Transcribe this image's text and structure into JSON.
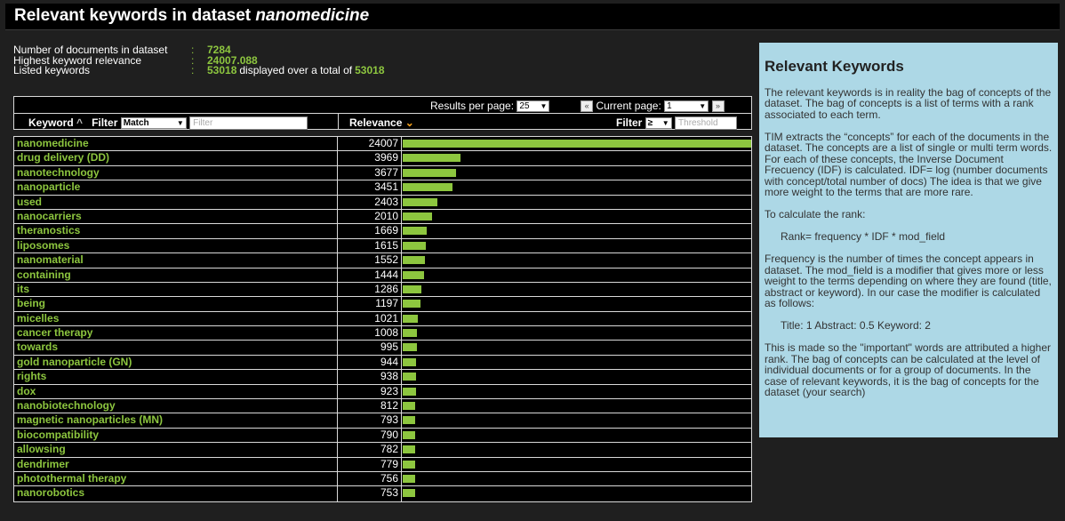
{
  "title": {
    "prefix": "Relevant keywords in dataset ",
    "dataset": "nanomedicine"
  },
  "stats": {
    "docs_label": "Number of documents in dataset",
    "docs_value": "7284",
    "highest_label": "Highest keyword relevance",
    "highest_value": "24007.088",
    "listed_label": "Listed keywords",
    "listed_value": "53018",
    "listed_middle": "displayed over a total of",
    "listed_total": "53018",
    "sep": ":"
  },
  "controls": {
    "results_per_page_label": "Results per page:",
    "results_per_page_value": "25",
    "prev_label": "«",
    "current_page_label": "Current page:",
    "current_page_value": "1",
    "next_label": "»",
    "keyword_header": "Keyword",
    "filter_label": "Filter",
    "filter_mode": "Match",
    "filter_placeholder": "Filter",
    "relevance_header": "Relevance",
    "threshold_filter_label": "Filter",
    "threshold_op": "≥",
    "threshold_placeholder": "Threshold",
    "sort_up_arrow": "^",
    "sort_down_arrow": "⌄",
    "select_arrow": "▼"
  },
  "keywords": [
    {
      "term": "nanomedicine",
      "relevance": "24007"
    },
    {
      "term": "drug delivery (DD)",
      "relevance": "3969"
    },
    {
      "term": "nanotechnology",
      "relevance": "3677"
    },
    {
      "term": "nanoparticle",
      "relevance": "3451"
    },
    {
      "term": "used",
      "relevance": "2403"
    },
    {
      "term": "nanocarriers",
      "relevance": "2010"
    },
    {
      "term": "theranostics",
      "relevance": "1669"
    },
    {
      "term": "liposomes",
      "relevance": "1615"
    },
    {
      "term": "nanomaterial",
      "relevance": "1552"
    },
    {
      "term": "containing",
      "relevance": "1444"
    },
    {
      "term": "its",
      "relevance": "1286"
    },
    {
      "term": "being",
      "relevance": "1197"
    },
    {
      "term": "micelles",
      "relevance": "1021"
    },
    {
      "term": "cancer therapy",
      "relevance": "1008"
    },
    {
      "term": "towards",
      "relevance": "995"
    },
    {
      "term": "gold nanoparticle (GN)",
      "relevance": "944"
    },
    {
      "term": "rights",
      "relevance": "938"
    },
    {
      "term": "dox",
      "relevance": "923"
    },
    {
      "term": "nanobiotechnology",
      "relevance": "812"
    },
    {
      "term": "magnetic nanoparticles (MN)",
      "relevance": "793"
    },
    {
      "term": "biocompatibility",
      "relevance": "790"
    },
    {
      "term": "allowsing",
      "relevance": "782"
    },
    {
      "term": "dendrimer",
      "relevance": "779"
    },
    {
      "term": "photothermal therapy",
      "relevance": "756"
    },
    {
      "term": "nanorobotics",
      "relevance": "753"
    }
  ],
  "max_relevance": 24007.088,
  "info": {
    "heading": "Relevant Keywords",
    "p1": "The relevant keywords is in reality the bag of concepts of the dataset. The bag of concepts is a list of terms with a rank associated to each term.",
    "p2": "TIM extracts the “concepts” for each of the documents in the dataset. The concepts are a list of single or multi term words. For each of these concepts, the Inverse Document Frecuency (IDF) is calculated. IDF= log (number documents with concept/total number of docs) The idea is that we give more weight to the terms that are more rare.",
    "p3": "To calculate the rank:",
    "p4": "Rank= frequency * IDF * mod_field",
    "p5": "Frequency is the number of times the concept appears in dataset. The mod_field is a modifier that gives more or less weight to the terms depending on where they are found (title, abstract or keyword). In our case the modifier is calculated as follows:",
    "p6": "Title: 1 Abstract: 0.5 Keyword: 2",
    "p7": "This is made so the \"important\" words are attributed a higher rank. The bag of concepts can be calculated at the level of individual documents or for a group of documents. In the case of relevant keywords, it is the bag of concepts for the dataset (your search)"
  },
  "colors": {
    "accent_green": "#8dc63f",
    "info_bg": "#add8e6",
    "sort_orange": "#f7a21b"
  }
}
